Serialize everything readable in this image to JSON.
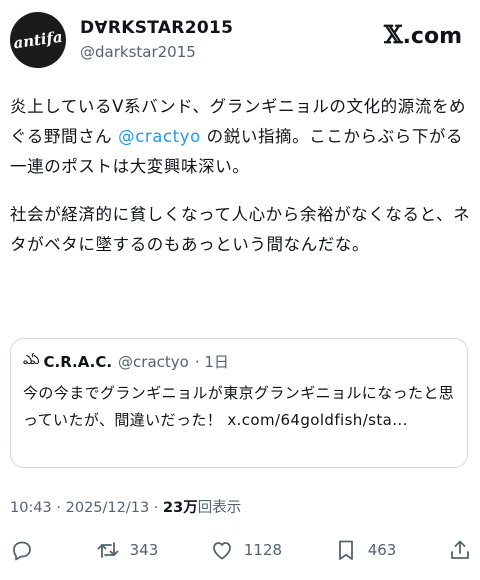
{
  "author": {
    "avatar_text": "antifa",
    "display_name": "D∀RKSTAR2015",
    "handle": "@darkstar2015"
  },
  "brand": {
    "x": "𝕏",
    "text": ".com"
  },
  "post": {
    "p1_before": "炎上しているV系バンド、グランギニョルの文化的源流をめぐる野間さん ",
    "p1_mention": "@cractyo",
    "p1_after": " の鋭い指摘。ここからぶら下がる一連のポストは大変興味深い。",
    "p2": "社会が経済的に貧しくなって人心から余裕がなくなると、ネタがベタに墜するのもあっという間なんだな。"
  },
  "quote": {
    "avatar": "ఎఏ",
    "name": "C.R.A.C.",
    "handle": "@cractyo",
    "time": "· 1日",
    "text": "今の今までグランギニョルが東京グランギニョルになったと思っていたが、間違いだった！ ",
    "link": "x.com/64goldfish/sta..."
  },
  "meta": {
    "datetime": "10:43 · 2025/12/13 · ",
    "views_count": "23万",
    "views_label": "回表示"
  },
  "actions": {
    "reply_count": "",
    "retweet_count": "343",
    "like_count": "1128",
    "bookmark_count": "463"
  }
}
